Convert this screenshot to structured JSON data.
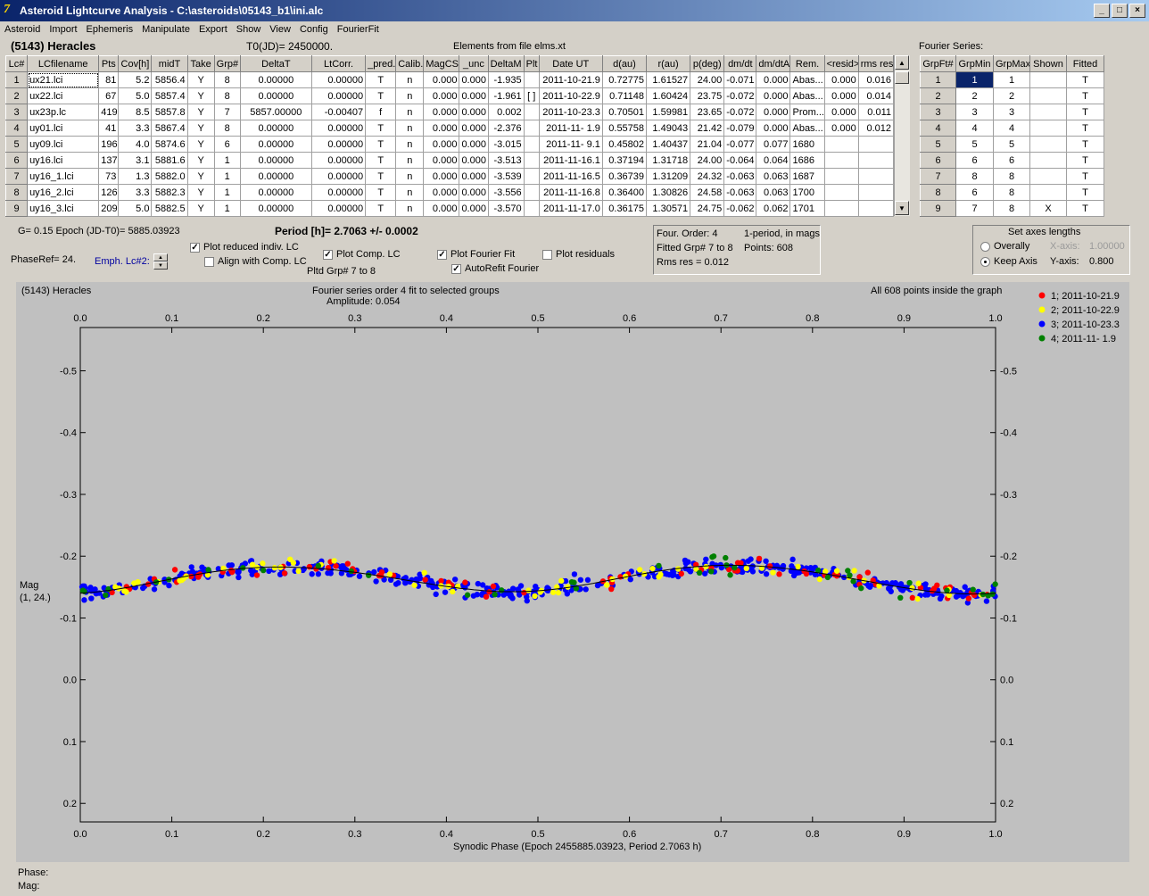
{
  "window": {
    "title": "Asteroid Lightcurve Analysis - C:\\asteroids\\05143_b1\\ini.alc",
    "min": "_",
    "max": "□",
    "close": "×"
  },
  "menu": [
    "Asteroid",
    "Import",
    "Ephemeris",
    "Manipulate",
    "Export",
    "Show",
    "View",
    "Config",
    "FourierFit"
  ],
  "header": {
    "asteroid": "(5143) Heracles",
    "t0": "T0(JD)= 2450000.",
    "elements": "Elements from file elms.xt",
    "fourier_series": "Fourier Series:"
  },
  "lc_table": {
    "columns": [
      "Lc#",
      "LCfilename",
      "Pts",
      "Cov[h]",
      "midT",
      "Take",
      "Grp#",
      "DeltaT",
      "LtCorr.",
      "_pred.",
      "Calib.",
      "MagCS",
      "_unc",
      "DeltaM",
      "Plt",
      "Date UT",
      "d(au)",
      "r(au)",
      "p(deg)",
      "dm/dt",
      "dm/dtA",
      "Rem.",
      "<resid>",
      "rms res"
    ],
    "rows": [
      [
        "1",
        "ux21.lci",
        "81",
        "5.2",
        "5856.4",
        "Y",
        "8",
        "0.00000",
        "0.00000",
        "T",
        "n",
        "0.000",
        "0.000",
        "-1.935",
        "",
        "2011-10-21.9",
        "0.72775",
        "1.61527",
        "24.00",
        "-0.071",
        "0.000",
        "Abas...",
        "0.000",
        "0.016"
      ],
      [
        "2",
        "ux22.lci",
        "67",
        "5.0",
        "5857.4",
        "Y",
        "8",
        "0.00000",
        "0.00000",
        "T",
        "n",
        "0.000",
        "0.000",
        "-1.961",
        "[ ]",
        "2011-10-22.9",
        "0.71148",
        "1.60424",
        "23.75",
        "-0.072",
        "0.000",
        "Abas...",
        "0.000",
        "0.014"
      ],
      [
        "3",
        "ux23p.lc",
        "419",
        "8.5",
        "5857.8",
        "Y",
        "7",
        "5857.00000",
        "-0.00407",
        "f",
        "n",
        "0.000",
        "0.000",
        "0.002",
        "",
        "2011-10-23.3",
        "0.70501",
        "1.59981",
        "23.65",
        "-0.072",
        "0.000",
        "Prom...",
        "0.000",
        "0.011"
      ],
      [
        "4",
        "uy01.lci",
        "41",
        "3.3",
        "5867.4",
        "Y",
        "8",
        "0.00000",
        "0.00000",
        "T",
        "n",
        "0.000",
        "0.000",
        "-2.376",
        "",
        "2011-11- 1.9",
        "0.55758",
        "1.49043",
        "21.42",
        "-0.079",
        "0.000",
        "Abas...",
        "0.000",
        "0.012"
      ],
      [
        "5",
        "uy09.lci",
        "196",
        "4.0",
        "5874.6",
        "Y",
        "6",
        "0.00000",
        "0.00000",
        "T",
        "n",
        "0.000",
        "0.000",
        "-3.015",
        "",
        "2011-11- 9.1",
        "0.45802",
        "1.40437",
        "21.04",
        "-0.077",
        "0.077",
        "1680",
        "",
        ""
      ],
      [
        "6",
        "uy16.lci",
        "137",
        "3.1",
        "5881.6",
        "Y",
        "1",
        "0.00000",
        "0.00000",
        "T",
        "n",
        "0.000",
        "0.000",
        "-3.513",
        "",
        "2011-11-16.1",
        "0.37194",
        "1.31718",
        "24.00",
        "-0.064",
        "0.064",
        "1686",
        "",
        ""
      ],
      [
        "7",
        "uy16_1.lci",
        "73",
        "1.3",
        "5882.0",
        "Y",
        "1",
        "0.00000",
        "0.00000",
        "T",
        "n",
        "0.000",
        "0.000",
        "-3.539",
        "",
        "2011-11-16.5",
        "0.36739",
        "1.31209",
        "24.32",
        "-0.063",
        "0.063",
        "1687",
        "",
        ""
      ],
      [
        "8",
        "uy16_2.lci",
        "126",
        "3.3",
        "5882.3",
        "Y",
        "1",
        "0.00000",
        "0.00000",
        "T",
        "n",
        "0.000",
        "0.000",
        "-3.556",
        "",
        "2011-11-16.8",
        "0.36400",
        "1.30826",
        "24.58",
        "-0.063",
        "0.063",
        "1700",
        "",
        ""
      ],
      [
        "9",
        "uy16_3.lci",
        "209",
        "5.0",
        "5882.5",
        "Y",
        "1",
        "0.00000",
        "0.00000",
        "T",
        "n",
        "0.000",
        "0.000",
        "-3.570",
        "",
        "2011-11-17.0",
        "0.36175",
        "1.30571",
        "24.75",
        "-0.062",
        "0.062",
        "1701",
        "",
        ""
      ]
    ]
  },
  "fourier_table": {
    "columns": [
      "GrpFt#",
      "GrpMin",
      "GrpMax",
      "Shown",
      "Fitted"
    ],
    "rows": [
      [
        "1",
        "1",
        "1",
        "",
        "T"
      ],
      [
        "2",
        "2",
        "2",
        "",
        "T"
      ],
      [
        "3",
        "3",
        "3",
        "",
        "T"
      ],
      [
        "4",
        "4",
        "4",
        "",
        "T"
      ],
      [
        "5",
        "5",
        "5",
        "",
        "T"
      ],
      [
        "6",
        "6",
        "6",
        "",
        "T"
      ],
      [
        "7",
        "8",
        "8",
        "",
        "T"
      ],
      [
        "8",
        "6",
        "8",
        "",
        "T"
      ],
      [
        "9",
        "7",
        "8",
        "X",
        "T"
      ]
    ]
  },
  "controls": {
    "g_epoch": "G= 0.15   Epoch (JD-T0)= 5885.03923",
    "period": "Period [h]= 2.7063 +/- 0.0002",
    "phaseref": "PhaseRef= 24.",
    "emph": "Emph. Lc#2:",
    "plot_reduced": "Plot reduced indiv. LC",
    "align_comp": "Align with Comp. LC",
    "plot_comp": "Plot Comp. LC",
    "pltd_grp": "Pltd Grp#  7   to   8",
    "plot_fourier": "Plot Fourier Fit",
    "autorefit": "AutoRefit Fourier",
    "plot_residuals": "Plot residuals"
  },
  "info_box": {
    "four_order": "Four. Order:  4",
    "period_mode": "1-period, in mags",
    "fitted": "Fitted Grp# 7 to 8",
    "points": "Points: 608",
    "rms": "Rms res     = 0.012"
  },
  "axes_box": {
    "title": "Set axes lengths",
    "overally": "Overally",
    "keep_axis": "Keep Axis",
    "x_label": "X-axis:",
    "x_value": "1.00000",
    "y_label": "Y-axis:",
    "y_value": "0.800"
  },
  "plot": {
    "name": "(5143) Heracles",
    "fourier_title": "Fourier series order 4 fit to selected groups",
    "amplitude": "Amplitude: 0.054",
    "points_note": "All 608 points inside the graph",
    "ylabel_1": "Mag",
    "ylabel_2": "(1, 24.)",
    "xlabel": "Synodic Phase (Epoch 2455885.03923, Period 2.7063 h)"
  },
  "status": {
    "phase": "Phase:",
    "mag": "Mag:"
  },
  "chart_data": {
    "type": "scatter",
    "x_ticks": [
      "0.0",
      "0.1",
      "0.2",
      "0.3",
      "0.4",
      "0.5",
      "0.6",
      "0.7",
      "0.8",
      "0.9",
      "1.0"
    ],
    "y_ticks": [
      "-0.5",
      "-0.4",
      "-0.3",
      "-0.2",
      "-0.1",
      "0.0",
      "0.1",
      "0.2"
    ],
    "xlim": [
      0,
      1
    ],
    "ylim": [
      -0.57,
      0.23
    ],
    "y_inverted": true,
    "grid": false,
    "legend_position": "top-right",
    "series": [
      {
        "name": "1; 2011-10-21.9",
        "color": "#ff0000",
        "count": 81
      },
      {
        "name": "2; 2011-10-22.9",
        "color": "#ffff00",
        "count": 67
      },
      {
        "name": "3; 2011-10-23.3",
        "color": "#0000ff",
        "count": 419
      },
      {
        "name": "4; 2011-11- 1.9",
        "color": "#008000",
        "count": 41
      }
    ],
    "fourier_fit": {
      "order": 4,
      "mean": -0.163,
      "amplitude": 0.054,
      "cos": [
        0.002,
        0.02,
        0.0,
        0.001
      ],
      "sin": [
        0.001,
        -0.008,
        0.0,
        0.0
      ]
    }
  }
}
